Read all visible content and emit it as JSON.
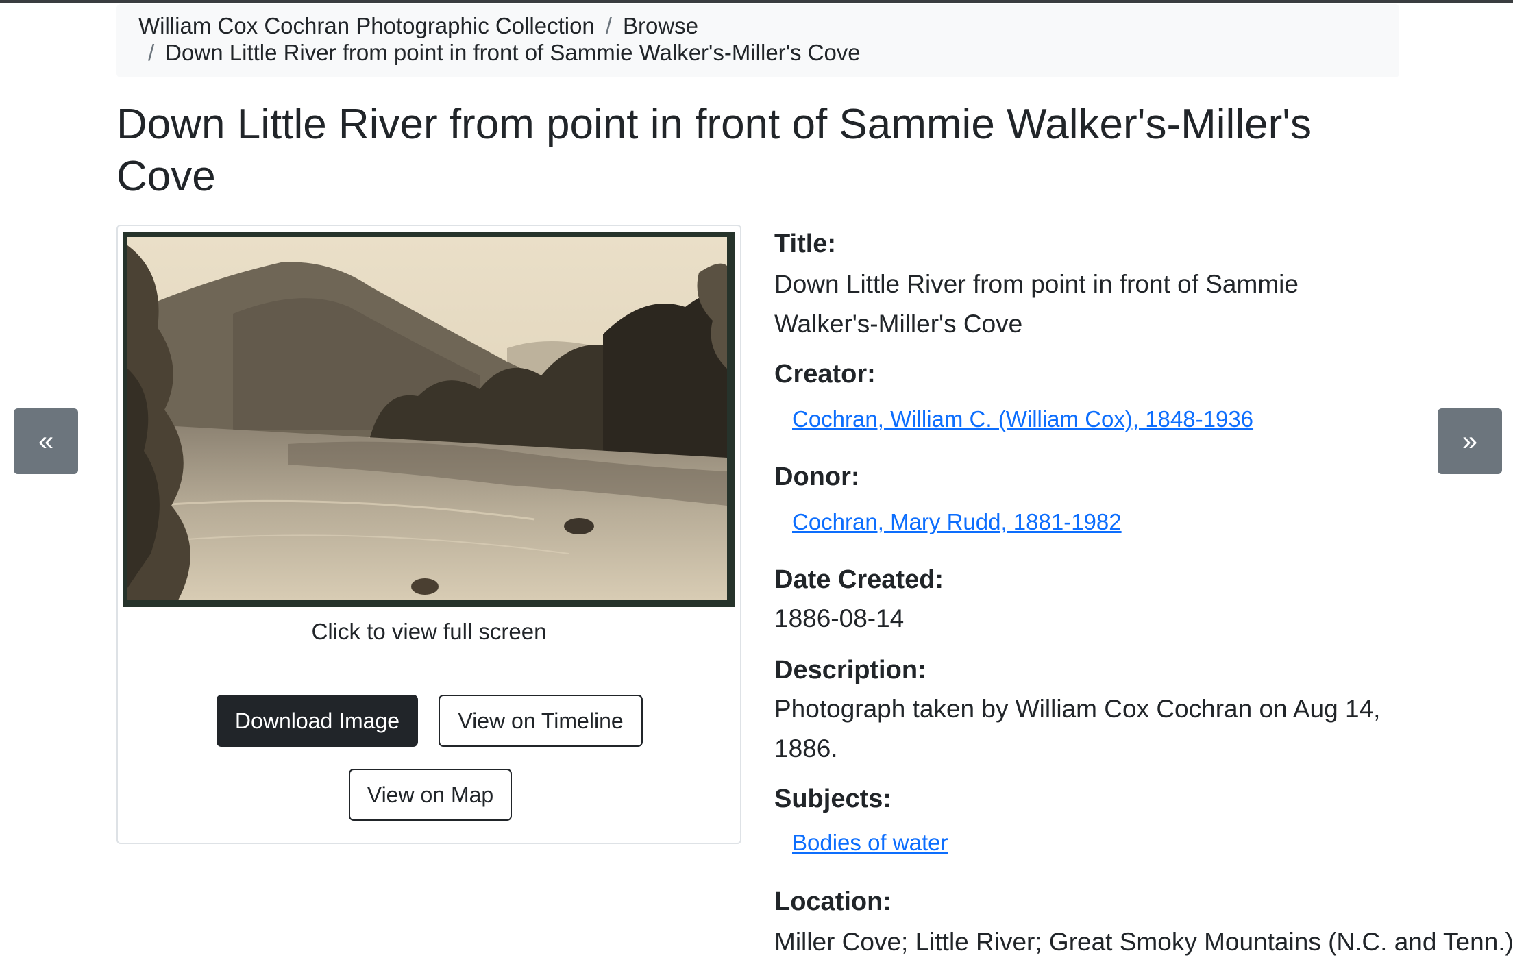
{
  "breadcrumb": {
    "collection": "William Cox Cochran Photographic Collection",
    "browse": "Browse",
    "current": "Down Little River from point in front of Sammie Walker's-Miller's Cove",
    "separator": "/"
  },
  "page_title": "Down Little River from point in front of Sammie Walker's-Miller's Cove",
  "image_card": {
    "caption": "Click to view full screen",
    "download_label": "Download Image",
    "timeline_label": "View on Timeline",
    "map_label": "View on Map"
  },
  "metadata": {
    "title_label": "Title:",
    "title_value": "Down Little River from point in front of Sammie Walker's-Miller's Cove",
    "creator_label": "Creator:",
    "creator_value": "Cochran, William C. (William Cox), 1848-1936",
    "donor_label": "Donor:",
    "donor_value": "Cochran, Mary Rudd, 1881-1982",
    "date_label": "Date Created:",
    "date_value": "1886-08-14",
    "description_label": "Description:",
    "description_value": "Photograph taken by William Cox Cochran on Aug 14, 1886.",
    "subjects_label": "Subjects:",
    "subjects_value": "Bodies of water",
    "location_label": "Location:",
    "location_value": "Miller Cove; Little River; Great Smoky Mountains (N.C. and Tenn.)"
  },
  "nav": {
    "prev_label": "«",
    "next_label": "»"
  },
  "colors": {
    "link": "#0d6efd",
    "dark_button": "#212529",
    "nav_button": "#6c757d",
    "breadcrumb_bg": "#f8f9fa"
  }
}
